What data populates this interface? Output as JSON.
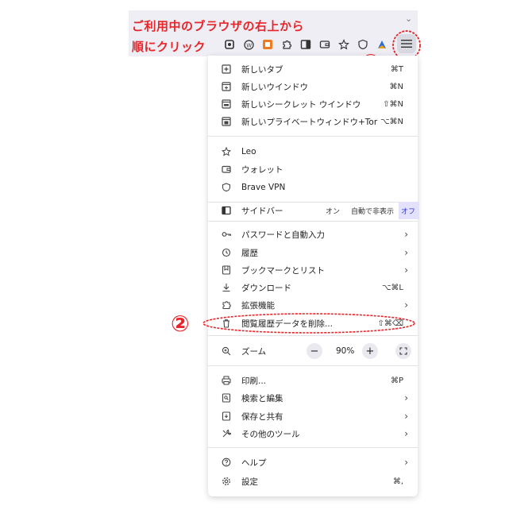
{
  "instruction": {
    "line1": "ご利用中のブラウザの右上から",
    "line2": "順にクリック"
  },
  "markers": {
    "step1": "①",
    "step2": "②"
  },
  "menu": {
    "items": [
      {
        "label": "新しいタブ",
        "shortcut": "⌘T",
        "icon": "new-tab-icon"
      },
      {
        "label": "新しいウインドウ",
        "shortcut": "⌘N",
        "icon": "new-window-icon"
      },
      {
        "label": "新しいシークレット ウインドウ",
        "shortcut": "⇧⌘N",
        "icon": "incognito-window-icon"
      },
      {
        "label": "新しいプライベートウィンドウ+Tor",
        "shortcut": "⌥⌘N",
        "icon": "private-tor-window-icon"
      },
      {
        "label": "Leo",
        "icon": "leo-star-icon"
      },
      {
        "label": "ウォレット",
        "icon": "wallet-icon"
      },
      {
        "label": "Brave VPN",
        "icon": "vpn-icon"
      },
      {
        "label": "サイドバー",
        "icon": "sidebar-icon"
      },
      {
        "label": "パスワードと自動入力",
        "icon": "key-icon"
      },
      {
        "label": "履歴",
        "icon": "history-icon"
      },
      {
        "label": "ブックマークとリスト",
        "icon": "bookmark-icon"
      },
      {
        "label": "ダウンロード",
        "shortcut": "⌥⌘L",
        "icon": "download-icon"
      },
      {
        "label": "拡張機能",
        "icon": "puzzle-icon"
      },
      {
        "label": "閲覧履歴データを削除...",
        "shortcut": "⇧⌘⌫",
        "icon": "trash-icon"
      },
      {
        "label": "ズーム",
        "icon": "zoom-icon"
      },
      {
        "label": "印刷...",
        "shortcut": "⌘P",
        "icon": "print-icon"
      },
      {
        "label": "検索と編集",
        "icon": "search-edit-icon"
      },
      {
        "label": "保存と共有",
        "icon": "save-share-icon"
      },
      {
        "label": "その他のツール",
        "icon": "tools-icon"
      },
      {
        "label": "ヘルプ",
        "icon": "help-icon"
      },
      {
        "label": "設定",
        "shortcut": "⌘,",
        "icon": "gear-icon"
      }
    ],
    "sidebar_options": {
      "on": "オン",
      "auto": "自動で非表示",
      "off": "オフ"
    },
    "zoom": {
      "minus": "−",
      "value": "90%",
      "plus": "+"
    }
  },
  "colors": {
    "accent": "#e8252a",
    "selected_seg_bg": "#e3e1fb"
  }
}
